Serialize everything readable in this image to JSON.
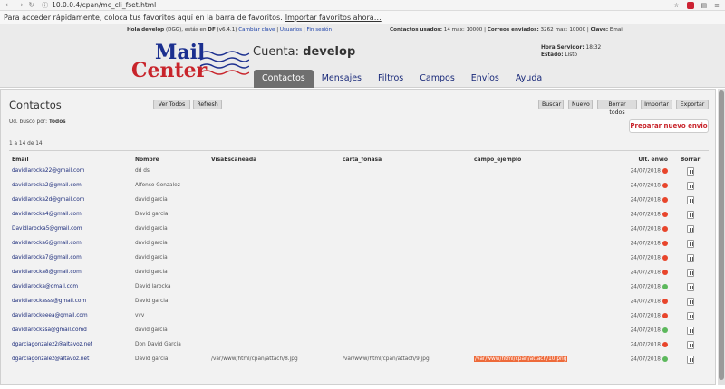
{
  "browser": {
    "url": "10.0.0.4/cpan/mc_cli_fset.html",
    "bookmarks_text": "Para acceder rápidamente, coloca tus favoritos aquí en la barra de favoritos.",
    "bookmarks_link": "Importar favoritos ahora…"
  },
  "topinfo": {
    "hola_label": "Hola develop",
    "hola_detail": "(DGG), estás en",
    "df": "DF",
    "version": "(v6.4.1)",
    "cambiar_clave": "Cambiar clave",
    "usuarios": "Usuarios",
    "fin_sesion": "Fin sesión",
    "contactos_label": "Contactos usados:",
    "contactos_val": "14 max: 10000",
    "correos_label": "Correos enviados:",
    "correos_val": "3262 max: 10000",
    "clave_label": "Clave:",
    "clave_val": "Email"
  },
  "logo": {
    "mail": "Mail",
    "center": "Center"
  },
  "account": {
    "label": "Cuenta:",
    "name": "develop"
  },
  "server": {
    "hora_label": "Hora Servidor:",
    "hora_val": "18:32",
    "estado_label": "Estado:",
    "estado_val": "Listo"
  },
  "tabs": [
    "Contactos",
    "Mensajes",
    "Filtros",
    "Campos",
    "Envíos",
    "Ayuda"
  ],
  "page": {
    "title": "Contactos",
    "ver_todos": "Ver Todos",
    "refresh": "Refresh",
    "buscar": "Buscar",
    "nuevo": "Nuevo",
    "borrar_todos": "Borrar todos",
    "importar": "Importar",
    "exportar": "Exportar",
    "busco_label": "Ud. buscó por:",
    "busco_val": "Todos",
    "preparar": "Preparar nuevo envio",
    "range": "1 a 14 de 14"
  },
  "table": {
    "headers": [
      "Email",
      "Nombre",
      "VisaEscaneada",
      "carta_fonasa",
      "campo_ejemplo",
      "Ult. envio",
      "Borrar"
    ],
    "rows": [
      {
        "email": "davidlarocka22@gmail.com",
        "nombre": "dd ds",
        "visa": "",
        "carta": "",
        "campo": "",
        "ult": "24/07/2018",
        "status": "red"
      },
      {
        "email": "davidlarocka2@gmail.com",
        "nombre": "Alfonso Gonzalez",
        "visa": "",
        "carta": "",
        "campo": "",
        "ult": "24/07/2018",
        "status": "red"
      },
      {
        "email": "davidlarocka2d@gmail.com",
        "nombre": "david garcia",
        "visa": "",
        "carta": "",
        "campo": "",
        "ult": "24/07/2018",
        "status": "red"
      },
      {
        "email": "davidlarocka4@gmail.com",
        "nombre": "David garcia",
        "visa": "",
        "carta": "",
        "campo": "",
        "ult": "24/07/2018",
        "status": "red"
      },
      {
        "email": "Davidlarocka5@gmail.com",
        "nombre": "david garcia",
        "visa": "",
        "carta": "",
        "campo": "",
        "ult": "24/07/2018",
        "status": "red"
      },
      {
        "email": "davidlarocka6@gmail.com",
        "nombre": "david garcia",
        "visa": "",
        "carta": "",
        "campo": "",
        "ult": "24/07/2018",
        "status": "red"
      },
      {
        "email": "davidlarocka7@gmail.com",
        "nombre": "david garcia",
        "visa": "",
        "carta": "",
        "campo": "",
        "ult": "24/07/2018",
        "status": "red"
      },
      {
        "email": "davidlarocka8@gmail.com",
        "nombre": "david garcia",
        "visa": "",
        "carta": "",
        "campo": "",
        "ult": "24/07/2018",
        "status": "red"
      },
      {
        "email": "davidlarocka@gmail.com",
        "nombre": "David larocka",
        "visa": "",
        "carta": "",
        "campo": "",
        "ult": "24/07/2018",
        "status": "green"
      },
      {
        "email": "davidlarockasss@gmail.com",
        "nombre": "David garcia",
        "visa": "",
        "carta": "",
        "campo": "",
        "ult": "24/07/2018",
        "status": "red"
      },
      {
        "email": "davidlarockeeea@gmail.com",
        "nombre": "vvv",
        "visa": "",
        "carta": "",
        "campo": "",
        "ult": "24/07/2018",
        "status": "red"
      },
      {
        "email": "davidlarockssa@gmail.comd",
        "nombre": "david garcia",
        "visa": "",
        "carta": "",
        "campo": "",
        "ult": "24/07/2018",
        "status": "green"
      },
      {
        "email": "dgarciagonzalez2@altavoz.net",
        "nombre": "Don David Garcia",
        "visa": "",
        "carta": "",
        "campo": "",
        "ult": "24/07/2018",
        "status": "red"
      },
      {
        "email": "dgarciagonzalez@altavoz.net",
        "nombre": "David garcia",
        "visa": "/var/www/html/cpan/attach/8.jpg",
        "carta": "/var/www/html/cpan/attach/9.jpg",
        "campo": "/var/www/html/cpan/attach/10.png",
        "ult": "24/07/2018",
        "status": "green"
      }
    ]
  },
  "colors": {
    "accent_red": "#c8242b",
    "brand_blue": "#1b2f8f",
    "status_red": "#e8452b",
    "status_green": "#5cb85c"
  }
}
